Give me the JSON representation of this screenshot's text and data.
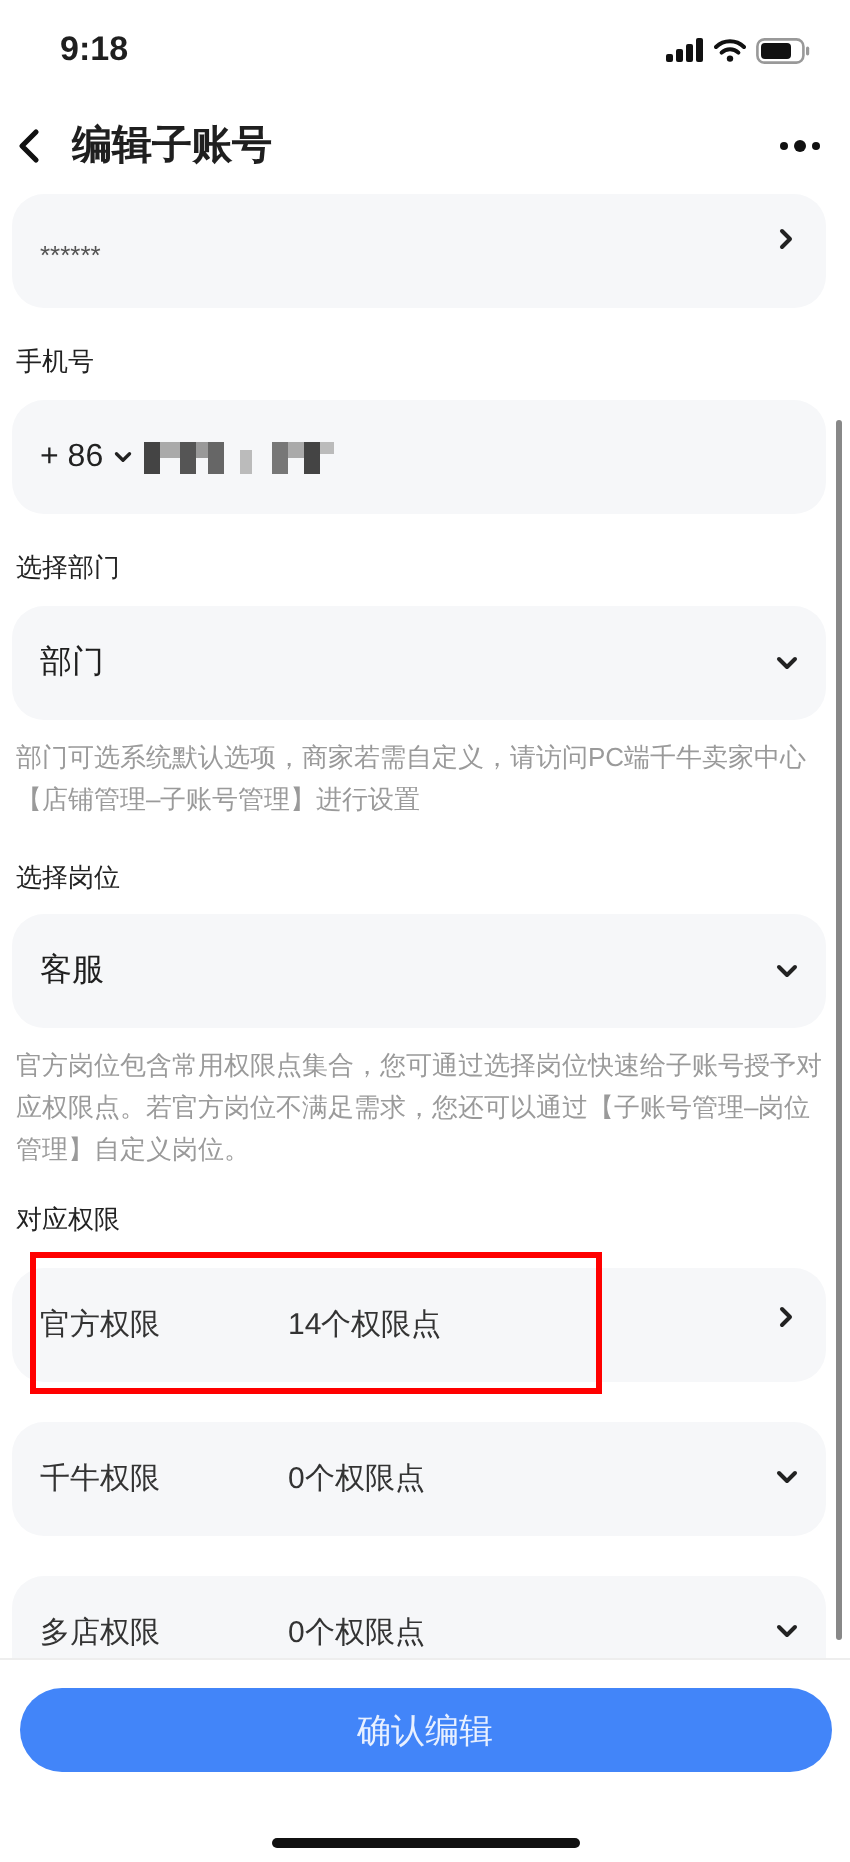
{
  "status_bar": {
    "time": "9:18"
  },
  "header": {
    "title": "编辑子账号"
  },
  "password_field": {
    "value": "******"
  },
  "phone": {
    "label": "手机号",
    "country_code": "+ 86"
  },
  "department": {
    "label": "选择部门",
    "value": "部门",
    "hint": "部门可选系统默认选项，商家若需自定义，请访问PC端千牛卖家中心【店铺管理–子账号管理】进行设置"
  },
  "position": {
    "label": "选择岗位",
    "value": "客服",
    "hint": "官方岗位包含常用权限点集合，您可通过选择岗位快速给子账号授予对应权限点。若官方岗位不满足需求，您还可以通过【子账号管理–岗位管理】自定义岗位。"
  },
  "permissions": {
    "label": "对应权限",
    "items": [
      {
        "name": "官方权限",
        "count": "14个权限点",
        "kind": "link",
        "highlighted": true
      },
      {
        "name": "千牛权限",
        "count": "0个权限点",
        "kind": "dropdown",
        "highlighted": false
      },
      {
        "name": "多店权限",
        "count": "0个权限点",
        "kind": "dropdown",
        "highlighted": false
      }
    ]
  },
  "confirm_button": "确认编辑"
}
